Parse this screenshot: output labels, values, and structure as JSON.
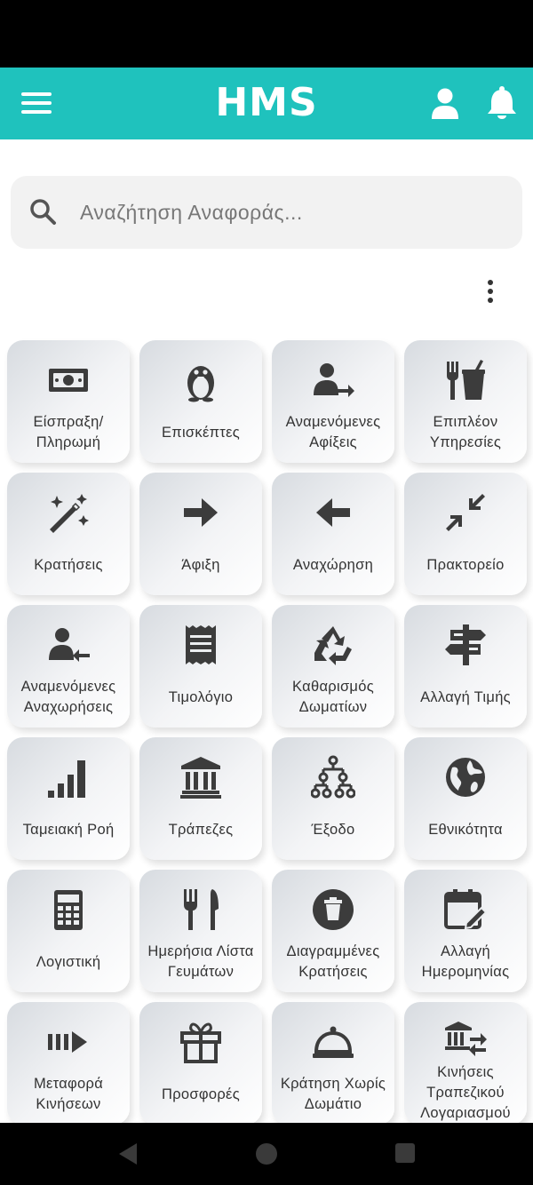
{
  "app": {
    "title": "HMS",
    "brand_color": "#1fc2bd",
    "icons": [
      "hamburger-menu-icon",
      "user-icon",
      "bell-icon"
    ]
  },
  "search": {
    "placeholder": "Αναζήτηση Αναφοράς..."
  },
  "tiles": [
    {
      "label": "Είσπραξη/\nΠληρωμή",
      "icon": "money-icon"
    },
    {
      "label": "Επισκέπτες",
      "icon": "penguin-icon"
    },
    {
      "label": "Αναμενόμενες\nΑφίξεις",
      "icon": "user-arrow-right-icon"
    },
    {
      "label": "Επιπλέον\nΥπηρεσίες",
      "icon": "fork-drink-icon"
    },
    {
      "label": "Κρατήσεις",
      "icon": "magic-wand-icon"
    },
    {
      "label": "Άφιξη",
      "icon": "arrow-right-icon"
    },
    {
      "label": "Αναχώρηση",
      "icon": "arrow-left-icon"
    },
    {
      "label": "Πρακτορείο",
      "icon": "compress-icon"
    },
    {
      "label": "Αναμενόμενες\nΑναχωρήσεις",
      "icon": "user-arrow-left-icon"
    },
    {
      "label": "Τιμολόγιο",
      "icon": "receipt-icon"
    },
    {
      "label": "Καθαρισμός\nΔωματίων",
      "icon": "recycle-icon"
    },
    {
      "label": "Αλλαγή Τιμής",
      "icon": "signpost-icon"
    },
    {
      "label": "Ταμειακή Ροή",
      "icon": "signal-bars-icon"
    },
    {
      "label": "Τράπεζες",
      "icon": "bank-icon"
    },
    {
      "label": "Έξοδο",
      "icon": "sitemap-icon"
    },
    {
      "label": "Εθνικότητα",
      "icon": "globe-icon"
    },
    {
      "label": "Λογιστική",
      "icon": "calculator-icon"
    },
    {
      "label": "Ημερήσια Λίστα\nΓευμάτων",
      "icon": "utensils-icon"
    },
    {
      "label": "Διαγραμμένες\nΚρατήσεις",
      "icon": "trash-circle-icon"
    },
    {
      "label": "Αλλαγή\nΗμερομηνίας",
      "icon": "calendar-edit-icon"
    },
    {
      "label": "Μεταφορά\nΚινήσεων",
      "icon": "transfer-arrow-icon"
    },
    {
      "label": "Προσφορές",
      "icon": "gift-icon"
    },
    {
      "label": "Κράτηση Χωρίς\nΔωμάτιο",
      "icon": "cloche-icon"
    },
    {
      "label": "Κινήσεις\nΤραπεζικού\nΛογαριασμού",
      "icon": "bank-transfer-icon"
    }
  ],
  "system_nav": [
    "back-icon",
    "home-icon",
    "recents-icon"
  ]
}
